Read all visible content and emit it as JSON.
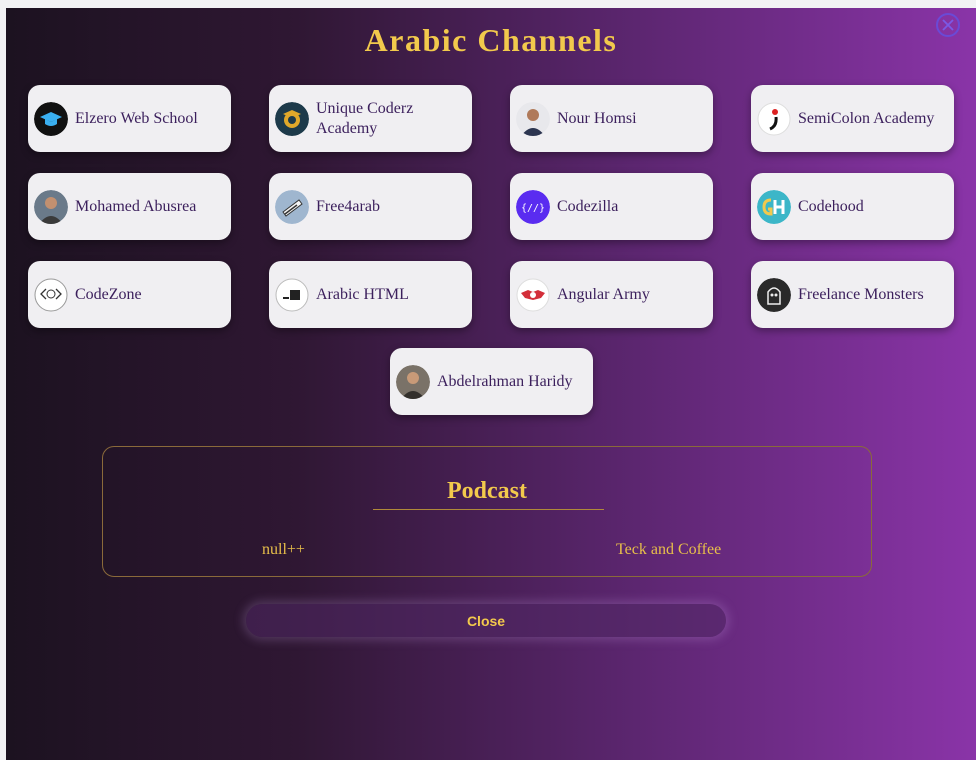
{
  "modal": {
    "title": "Arabic Channels",
    "close_button_label": "Close"
  },
  "channels": [
    {
      "name": "Elzero Web School",
      "icon": "graduation-cap-icon"
    },
    {
      "name": "Unique Coderz Academy",
      "icon": "academy-logo-icon"
    },
    {
      "name": "Nour Homsi",
      "icon": "avatar-photo"
    },
    {
      "name": "SemiColon Academy",
      "icon": "semicolon-logo-icon"
    },
    {
      "name": "Mohamed Abusrea",
      "icon": "avatar-photo"
    },
    {
      "name": "Free4arab",
      "icon": "free4arab-logo-icon"
    },
    {
      "name": "Codezilla",
      "icon": "code-brackets-icon"
    },
    {
      "name": "Codehood",
      "icon": "codehood-logo-icon"
    },
    {
      "name": "CodeZone",
      "icon": "codezone-logo-icon"
    },
    {
      "name": "Arabic HTML",
      "icon": "arabic-html-logo-icon"
    },
    {
      "name": "Angular Army",
      "icon": "angular-army-logo-icon"
    },
    {
      "name": "Freelance Monsters",
      "icon": "monster-logo-icon"
    },
    {
      "name": "Abdelrahman Haridy",
      "icon": "avatar-photo"
    }
  ],
  "podcast": {
    "title": "Podcast",
    "items": [
      "null++",
      "Teck and Coffee"
    ]
  },
  "colors": {
    "accent": "#f2c94c",
    "card_text": "#3b1f5c",
    "card_bg": "#f0eff2"
  }
}
